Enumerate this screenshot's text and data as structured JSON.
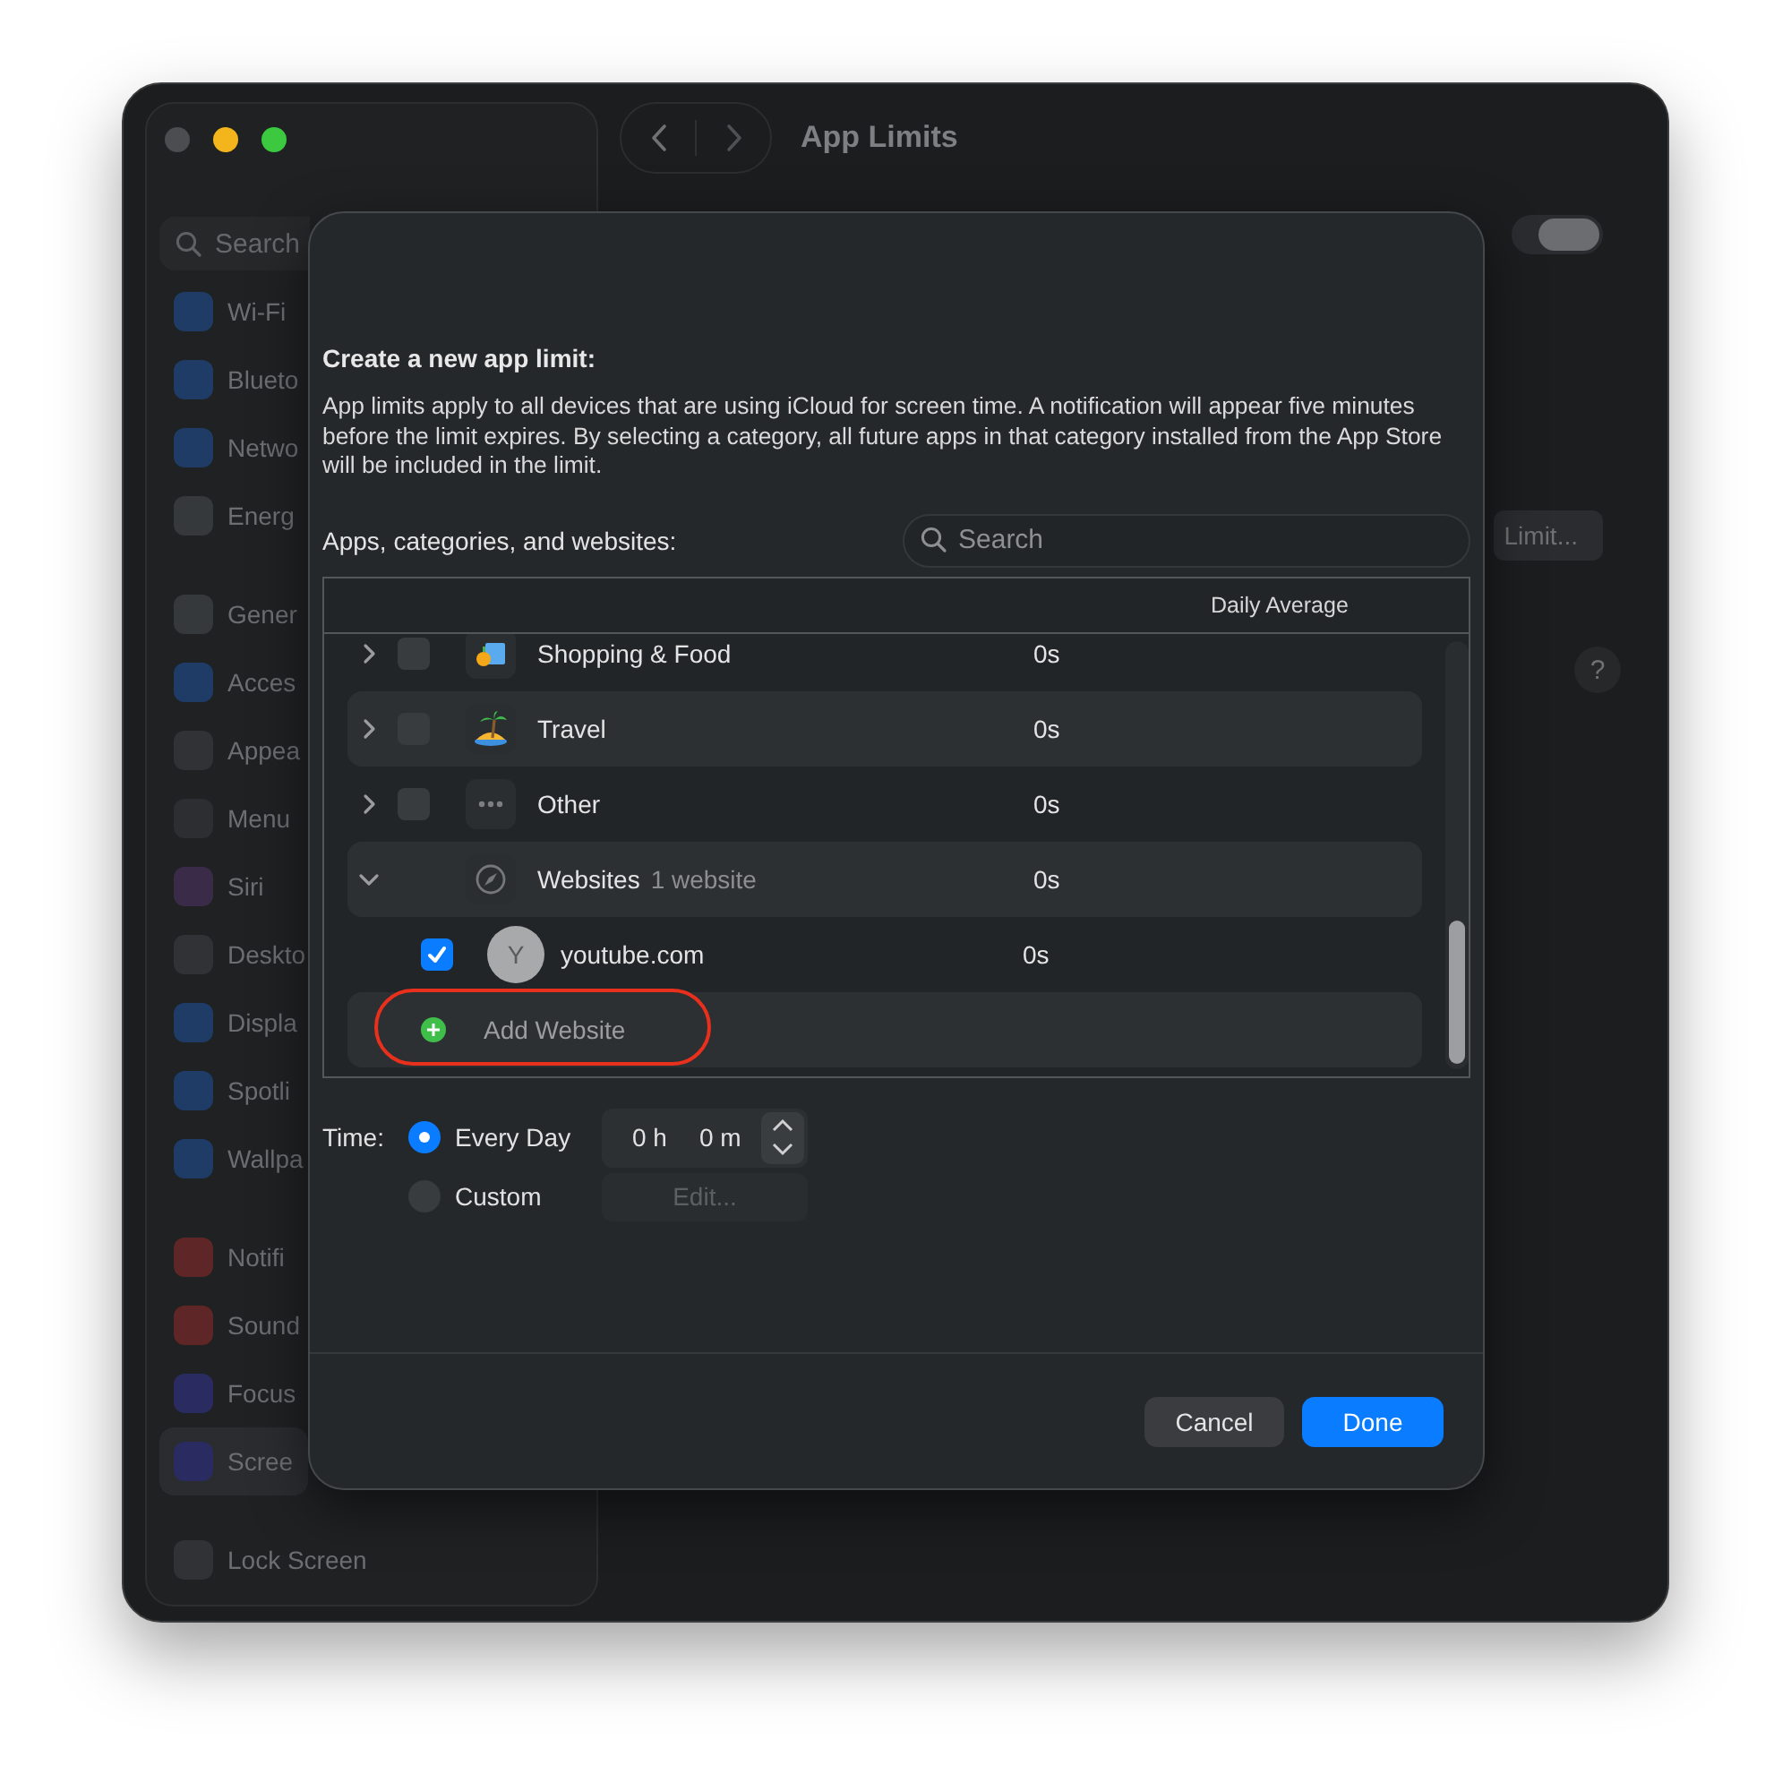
{
  "window": {
    "title": "App Limits"
  },
  "sidebar": {
    "search": {
      "placeholder": "Search"
    },
    "groups": [
      {
        "items": [
          {
            "label": "Wi-Fi",
            "color": "#1e3c66",
            "selected": false
          },
          {
            "label": "Blueto",
            "color": "#1e3c66",
            "selected": false
          },
          {
            "label": "Netwo",
            "color": "#1e3c66",
            "selected": false
          },
          {
            "label": "Energ",
            "color": "#36393c",
            "selected": false
          }
        ]
      },
      {
        "items": [
          {
            "label": "Gener",
            "color": "#36393c",
            "selected": false
          },
          {
            "label": "Acces",
            "color": "#1e3c66",
            "selected": false
          },
          {
            "label": "Appea",
            "color": "#303236",
            "selected": false
          },
          {
            "label": "Menu",
            "color": "#2c2e31",
            "selected": false
          },
          {
            "label": "Siri",
            "color": "#3a2c48",
            "selected": false
          },
          {
            "label": "Deskto",
            "color": "#303236",
            "selected": false
          },
          {
            "label": "Displa",
            "color": "#1e3c66",
            "selected": false
          },
          {
            "label": "Spotli",
            "color": "#1e3c66",
            "selected": false
          },
          {
            "label": "Wallpa",
            "color": "#1e3c66",
            "selected": false
          }
        ]
      },
      {
        "items": [
          {
            "label": "Notifi",
            "color": "#5e2626",
            "selected": false
          },
          {
            "label": "Sound",
            "color": "#5e2626",
            "selected": false
          },
          {
            "label": "Focus",
            "color": "#2a2b60",
            "selected": false
          },
          {
            "label": "Scree",
            "color": "#2a2b60",
            "selected": true
          }
        ]
      },
      {
        "items": [
          {
            "label": "Lock Screen",
            "color": "#303236",
            "selected": false
          }
        ]
      }
    ]
  },
  "settings": {
    "toggle": {
      "on": true
    },
    "limit_button": "Limit...",
    "help_button": "?"
  },
  "dialog": {
    "heading": "Create a new app limit:",
    "description": "App limits apply to all devices that are using iCloud for screen time. A notification will appear five minutes before the limit expires. By selecting a category, all future apps in that category installed from the App Store will be included in the limit.",
    "list_label": "Apps, categories, and websites:",
    "search": {
      "placeholder": "Search"
    },
    "table": {
      "columns": [
        "Daily Average"
      ],
      "rows": [
        {
          "kind": "category",
          "name": "Shopping & Food",
          "time": "0s",
          "checked": false,
          "expanded": false
        },
        {
          "kind": "category",
          "name": "Travel",
          "time": "0s",
          "checked": false,
          "expanded": false
        },
        {
          "kind": "category",
          "name": "Other",
          "time": "0s",
          "checked": false,
          "expanded": false
        },
        {
          "kind": "category",
          "name": "Websites",
          "detail": "1 website",
          "time": "0s",
          "expanded": true,
          "children": [
            {
              "kind": "website",
              "avatar": "Y",
              "name": "youtube.com",
              "time": "0s",
              "checked": true
            }
          ]
        }
      ],
      "add_button": {
        "label": "Add Website",
        "highlighted": true
      }
    },
    "time": {
      "label": "Time:",
      "options": [
        {
          "label": "Every Day",
          "selected": true
        },
        {
          "label": "Custom",
          "selected": false
        }
      ],
      "hours": "0 h",
      "minutes": "0 m",
      "edit_button": {
        "label": "Edit...",
        "disabled": true
      }
    },
    "buttons": [
      {
        "label": "Cancel",
        "kind": "secondary"
      },
      {
        "label": "Done",
        "kind": "primary"
      }
    ]
  }
}
